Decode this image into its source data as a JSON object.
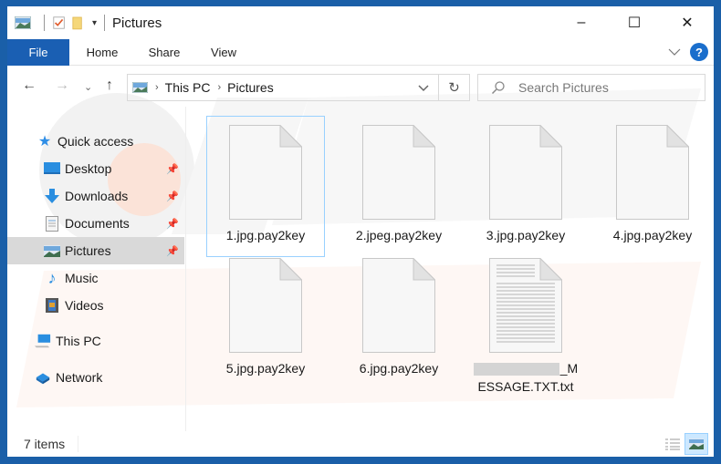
{
  "window": {
    "title": "Pictures",
    "controls": {
      "minimize": "–",
      "maximize": "☐",
      "close": "✕"
    }
  },
  "ribbon": {
    "tabs": [
      {
        "label": "File",
        "active": true
      },
      {
        "label": "Home"
      },
      {
        "label": "Share"
      },
      {
        "label": "View"
      }
    ],
    "help_label": "?"
  },
  "nav": {
    "breadcrumb": [
      "This PC",
      "Pictures"
    ],
    "search_placeholder": "Search Pictures"
  },
  "sidebar": {
    "items": [
      {
        "label": "Quick access",
        "icon": "star-icon",
        "pinned": false
      },
      {
        "label": "Desktop",
        "icon": "desktop-icon",
        "pinned": true
      },
      {
        "label": "Downloads",
        "icon": "download-icon",
        "pinned": true
      },
      {
        "label": "Documents",
        "icon": "documents-icon",
        "pinned": true
      },
      {
        "label": "Pictures",
        "icon": "pictures-icon",
        "pinned": true,
        "selected": true
      },
      {
        "label": "Music",
        "icon": "music-icon",
        "pinned": false
      },
      {
        "label": "Videos",
        "icon": "videos-icon",
        "pinned": false
      },
      {
        "label": "This PC",
        "icon": "computer-icon",
        "pinned": false
      },
      {
        "label": "Network",
        "icon": "network-icon",
        "pinned": false
      }
    ]
  },
  "files": [
    {
      "name": "1.jpg.pay2key",
      "type": "blank"
    },
    {
      "name": "2.jpeg.pay2key",
      "type": "blank"
    },
    {
      "name": "3.jpg.pay2key",
      "type": "blank"
    },
    {
      "name": "4.jpg.pay2key",
      "type": "blank"
    },
    {
      "name": "5.jpg.pay2key",
      "type": "blank"
    },
    {
      "name": "6.jpg.pay2key",
      "type": "blank"
    },
    {
      "name_line1_suffix": "_M",
      "name_line2": "ESSAGE.TXT.txt",
      "type": "text",
      "redacted_prefix": true
    }
  ],
  "status": {
    "item_count": "7 items"
  },
  "colors": {
    "accent": "#1a5fb3",
    "frame": "#1a5fa8",
    "selection": "#cce8ff",
    "selection_border": "#99d1ff"
  }
}
